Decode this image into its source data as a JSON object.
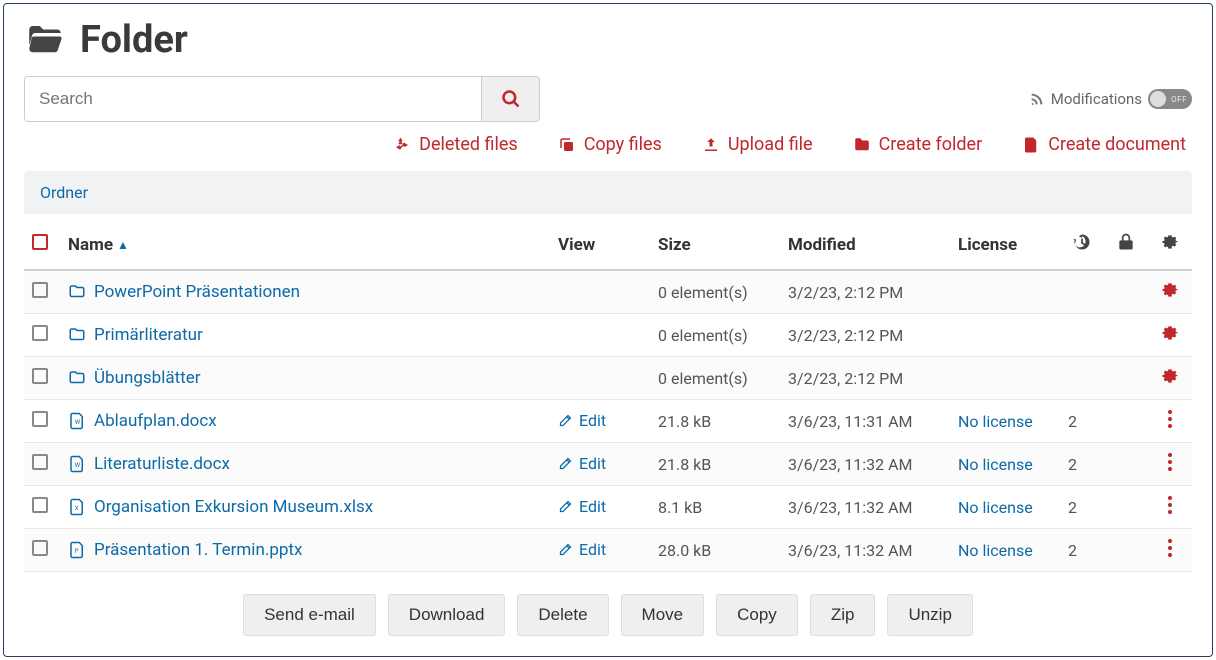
{
  "page_title": "Folder",
  "search": {
    "placeholder": "Search"
  },
  "modifications": {
    "label": "Modifications",
    "toggle_state": "OFF"
  },
  "toolbar": {
    "deleted_files": "Deleted files",
    "copy_files": "Copy files",
    "upload_file": "Upload file",
    "create_folder": "Create folder",
    "create_document": "Create document"
  },
  "breadcrumb": "Ordner",
  "columns": {
    "name": "Name",
    "view": "View",
    "size": "Size",
    "modified": "Modified",
    "license": "License"
  },
  "rows": [
    {
      "type": "folder",
      "name": "PowerPoint Präsentationen",
      "view": "",
      "size": "0 element(s)",
      "modified": "3/2/23, 2:12 PM",
      "license": "",
      "history": "",
      "settings": "gear"
    },
    {
      "type": "folder",
      "name": "Primärliteratur",
      "view": "",
      "size": "0 element(s)",
      "modified": "3/2/23, 2:12 PM",
      "license": "",
      "history": "",
      "settings": "gear"
    },
    {
      "type": "folder",
      "name": "Übungsblätter",
      "view": "",
      "size": "0 element(s)",
      "modified": "3/2/23, 2:12 PM",
      "license": "",
      "history": "",
      "settings": "gear"
    },
    {
      "type": "docx",
      "name": "Ablaufplan.docx",
      "view": "Edit",
      "size": "21.8 kB",
      "modified": "3/6/23, 11:31 AM",
      "license": "No license",
      "history": "2",
      "settings": "dots"
    },
    {
      "type": "docx",
      "name": "Literaturliste.docx",
      "view": "Edit",
      "size": "21.8 kB",
      "modified": "3/6/23, 11:32 AM",
      "license": "No license",
      "history": "2",
      "settings": "dots"
    },
    {
      "type": "xlsx",
      "name": "Organisation Exkursion Museum.xlsx",
      "view": "Edit",
      "size": "8.1 kB",
      "modified": "3/6/23, 11:32 AM",
      "license": "No license",
      "history": "2",
      "settings": "dots"
    },
    {
      "type": "pptx",
      "name": "Präsentation 1. Termin.pptx",
      "view": "Edit",
      "size": "28.0 kB",
      "modified": "3/6/23, 11:32 AM",
      "license": "No license",
      "history": "2",
      "settings": "dots"
    }
  ],
  "footer": {
    "send_email": "Send e-mail",
    "download": "Download",
    "delete": "Delete",
    "move": "Move",
    "copy": "Copy",
    "zip": "Zip",
    "unzip": "Unzip"
  }
}
